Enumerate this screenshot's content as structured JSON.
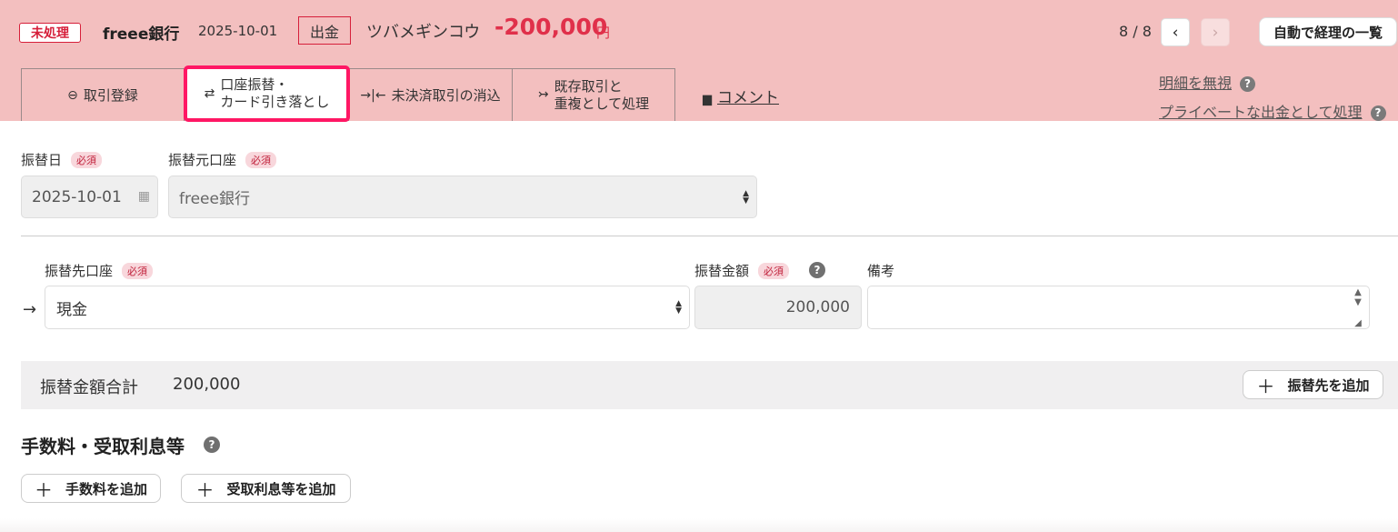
{
  "header": {
    "status_badge": "未処理",
    "bank_name": "freee銀行",
    "date": "2025-10-01",
    "direction": "出金",
    "payee": "ツバメギンコウ",
    "amount": "-200,000",
    "currency": "円",
    "pager": "8 / 8",
    "list_button": "自動で経理の一覧",
    "accent_color": "#e0304a",
    "band_color": "#f3bfbf"
  },
  "tabs": [
    {
      "label": "取引登録",
      "icon": "minus-circle-icon"
    },
    {
      "label_line1": "口座振替・",
      "label_line2": "カード引き落とし",
      "icon": "swap-arrows-icon",
      "selected": true
    },
    {
      "label": "未決済取引の消込",
      "icon": "merge-arrows-icon"
    },
    {
      "label_line1": "既存取引と",
      "label_line2": "重複として処理",
      "icon": "branch-arrow-icon"
    }
  ],
  "comment_link": "コメント",
  "side_links": {
    "ignore": "明細を無視",
    "private": "プライベートな出金として処理"
  },
  "form": {
    "date_label": "振替日",
    "required": "必須",
    "date_value": "2025-10-01",
    "from_label": "振替元口座",
    "from_value": "freee銀行",
    "to_label": "振替先口座",
    "to_value": "現金",
    "amount_label": "振替金額",
    "amount_value": "200,000",
    "memo_label": "備考",
    "memo_value": ""
  },
  "summary": {
    "label": "振替金額合計",
    "value": "200,000",
    "add_destination": "振替先を追加"
  },
  "fees": {
    "title": "手数料・受取利息等",
    "add_fee": "手数料を追加",
    "add_interest": "受取利息等を追加"
  }
}
